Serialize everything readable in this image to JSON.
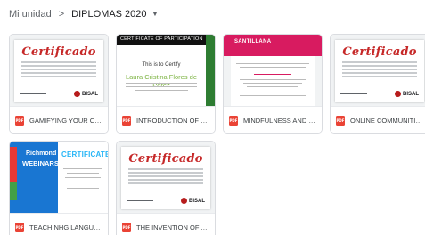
{
  "breadcrumb": {
    "root": "Mi unidad",
    "separator": ">",
    "current": "DIPLOMAS 2020",
    "caret_icon": "caret-down-icon"
  },
  "files": [
    {
      "name": "GAMIFYING YOUR CLASS...",
      "type_badge": "PDF",
      "thumb": {
        "title": "Certificado",
        "logo": "BISAL"
      }
    },
    {
      "name": "INTRODUCTION OF ELT ...",
      "type_badge": "PDF",
      "thumb": {
        "header": "CERTIFICATE OF PARTICIPATION",
        "certify": "This is to Certify",
        "recipient": "Laura Cristina Flores de Pérez"
      }
    },
    {
      "name": "MINDFULNESS AND EDU...",
      "type_badge": "PDF",
      "thumb": {
        "logo": "SANTILLANA"
      }
    },
    {
      "name": "ONLINE COMMUNITIES O...",
      "type_badge": "PDF",
      "thumb": {
        "title": "Certificado",
        "logo": "BISAL"
      }
    },
    {
      "name": "TEACHINHG LANGUAGE ...",
      "type_badge": "PDF",
      "thumb": {
        "brand": "Richmond",
        "line": "WEBINARS",
        "title": "CERTIFICATE"
      }
    },
    {
      "name": "THE INVENTION OF ADO...",
      "type_badge": "PDF",
      "thumb": {
        "title": "Certificado",
        "logo": "BISAL"
      }
    }
  ],
  "colors": {
    "pdf": "#ea4335",
    "certificado_red": "#c62828",
    "magenta": "#d81b60",
    "richmond_blue": "#1976d2"
  }
}
